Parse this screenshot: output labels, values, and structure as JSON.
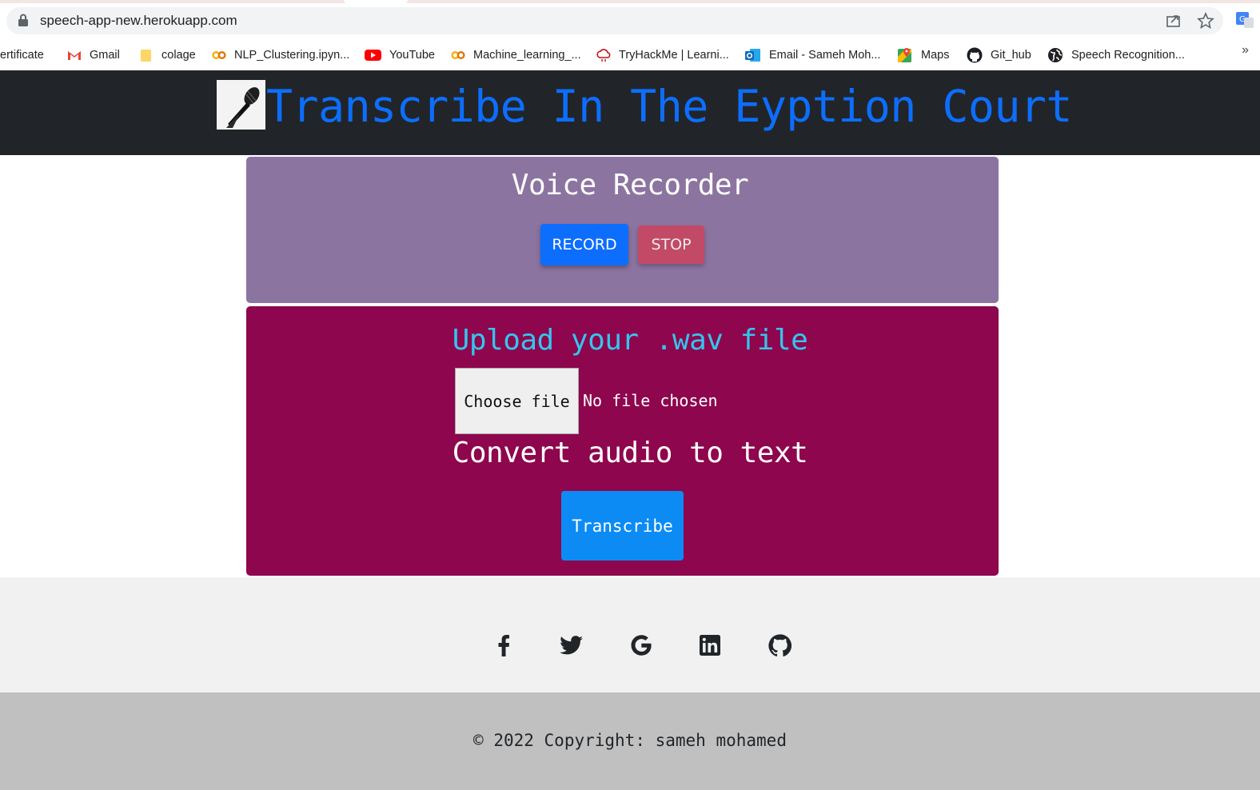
{
  "browser": {
    "url": "speech-app-new.herokuapp.com",
    "bookmarks": [
      {
        "label": "ertificate",
        "icon": "partial-bookmark"
      },
      {
        "label": "Gmail",
        "icon": "gmail-icon"
      },
      {
        "label": "colage",
        "icon": "folder-icon"
      },
      {
        "label": "NLP_Clustering.ipyn...",
        "icon": "colab-icon"
      },
      {
        "label": "YouTube",
        "icon": "youtube-icon"
      },
      {
        "label": "Machine_learning_...",
        "icon": "colab-icon"
      },
      {
        "label": "TryHackMe | Learni...",
        "icon": "tryhackme-icon"
      },
      {
        "label": "Email - Sameh Moh...",
        "icon": "outlook-icon"
      },
      {
        "label": "Maps",
        "icon": "maps-icon"
      },
      {
        "label": "Git_hub",
        "icon": "github-icon"
      },
      {
        "label": "Speech Recognition...",
        "icon": "globe-icon"
      }
    ],
    "more_label": "»"
  },
  "header": {
    "title": "Transcribe In The Eyption Court",
    "logo_icon": "microphone-icon"
  },
  "recorder": {
    "title": "Voice Recorder",
    "record_label": "RECORD",
    "stop_label": "STOP"
  },
  "upload": {
    "title": "Upload your .wav file",
    "choose_label": "Choose file",
    "file_status": "No file chosen",
    "convert_title": "Convert audio to text",
    "transcribe_label": "Transcribe"
  },
  "footer": {
    "social_icons": [
      "facebook-icon",
      "twitter-icon",
      "google-icon",
      "linkedin-icon",
      "github-icon"
    ],
    "copyright": "© 2022 Copyright: sameh mohamed"
  },
  "colors": {
    "header_bg": "#212529",
    "title_blue": "#0d6efd",
    "recorder_bg": "#8c74a1",
    "upload_bg": "#8e064d",
    "upload_title": "#34c5ef",
    "record_btn": "#0d6efd",
    "stop_btn": "#c24a66",
    "transcribe_btn": "#0d8bf5"
  }
}
